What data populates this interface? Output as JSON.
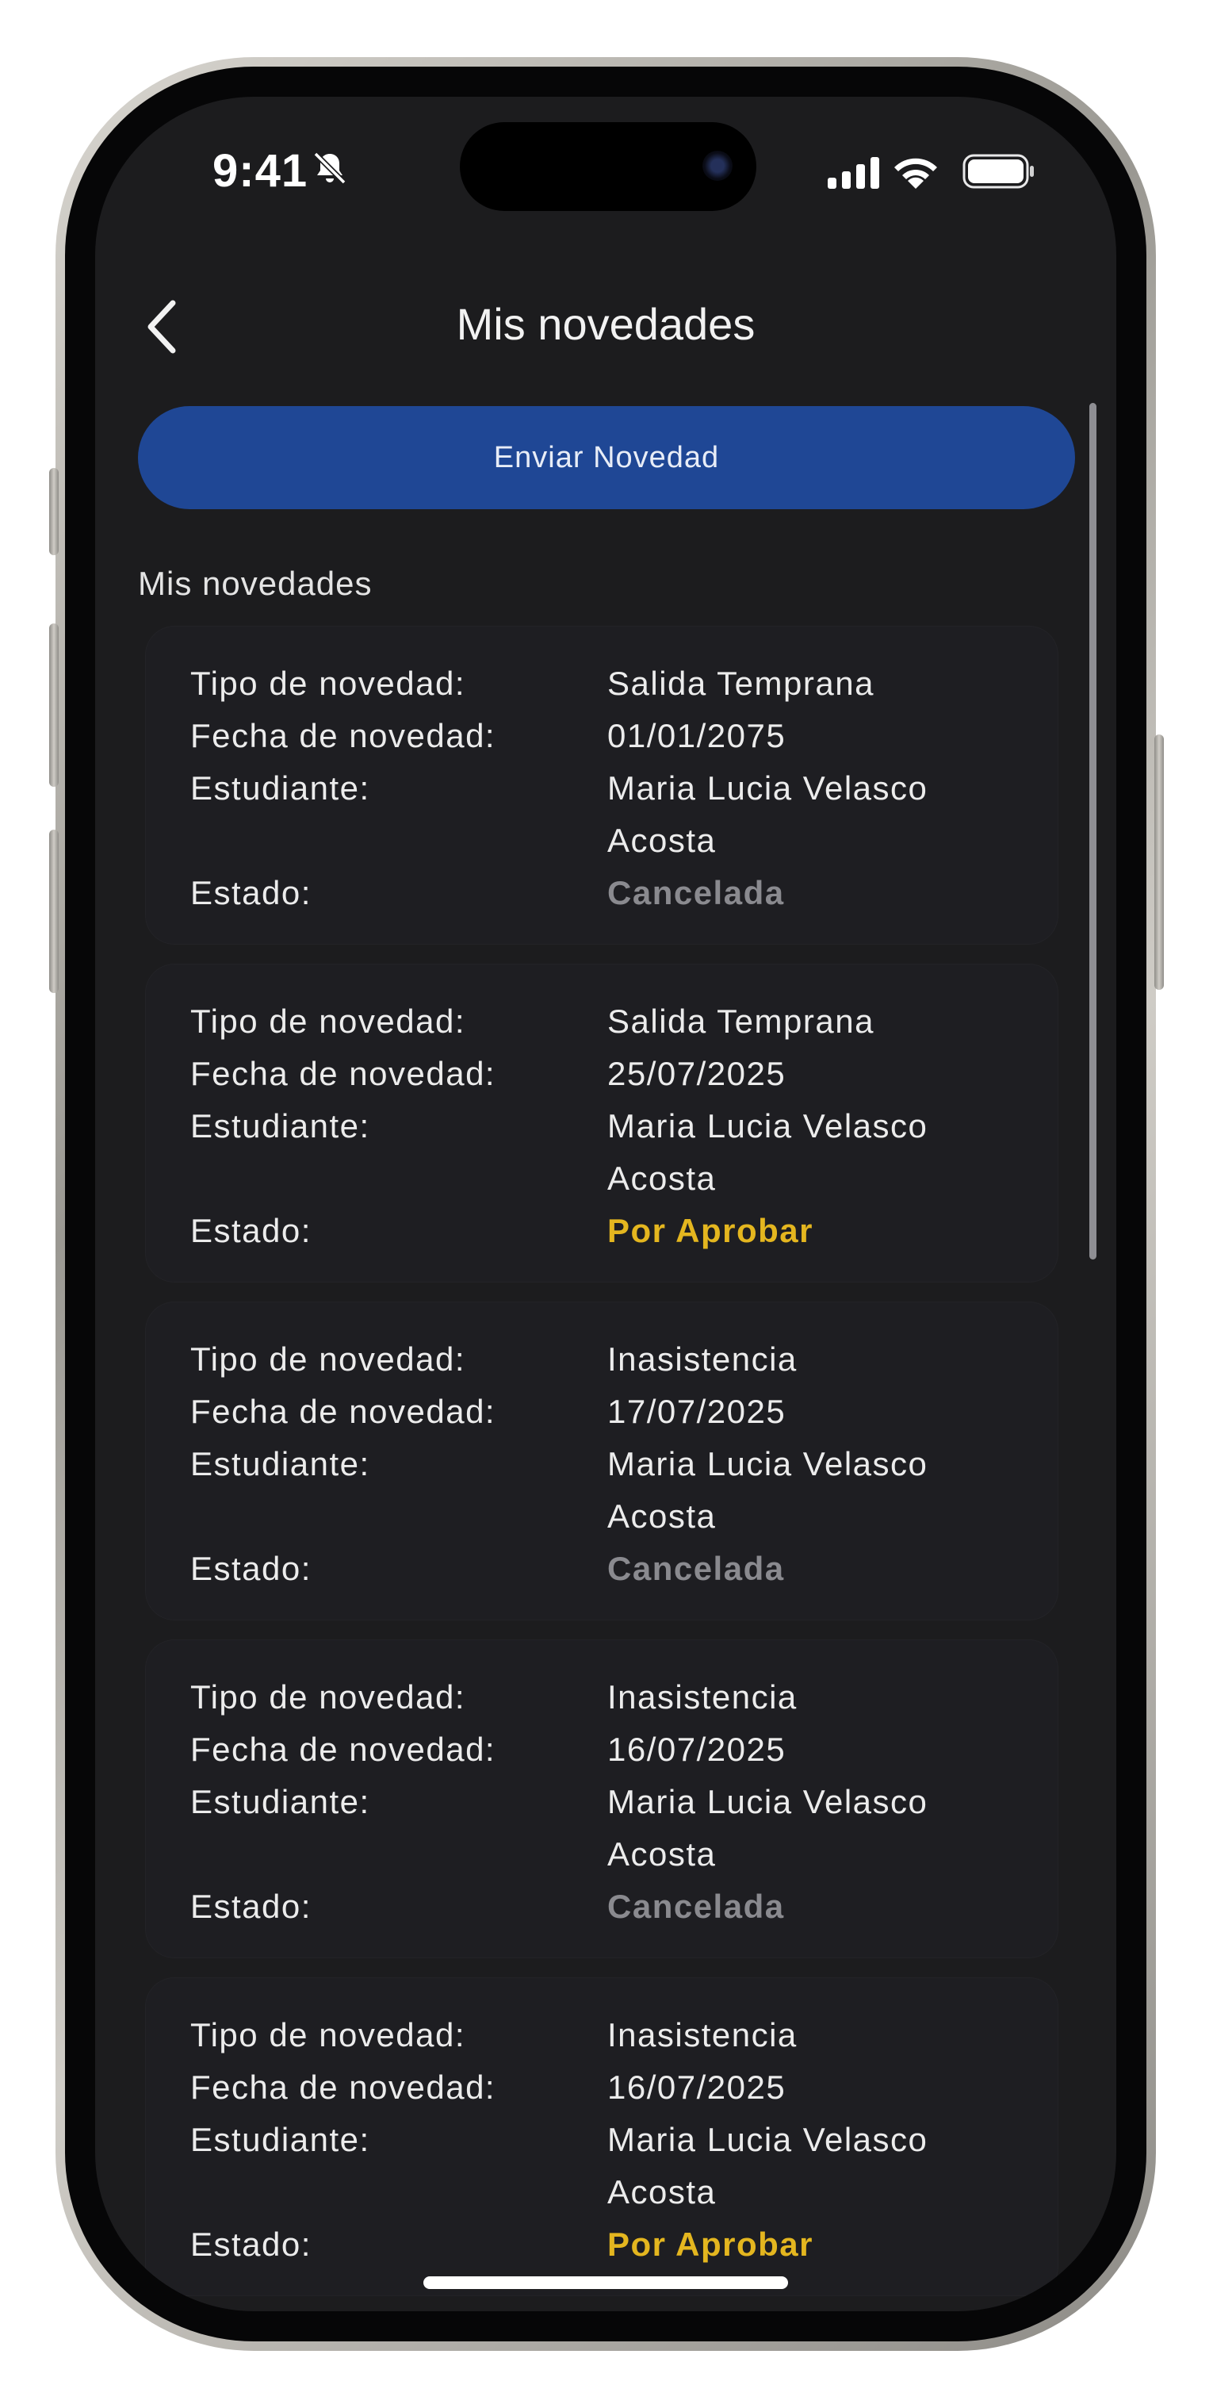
{
  "status_bar": {
    "time": "9:41"
  },
  "header": {
    "title": "Mis novedades"
  },
  "actions": {
    "send_label": "Enviar Novedad"
  },
  "section_title": "Mis novedades",
  "labels": {
    "type": "Tipo de novedad:",
    "date": "Fecha de novedad:",
    "student": "Estudiante:",
    "status": "Estado:"
  },
  "colors": {
    "accent": "#1f4795",
    "pending": "#e4b61f",
    "cancelled": "#8a8a8f"
  },
  "items": [
    {
      "type": "Salida Temprana",
      "date": "01/01/2075",
      "student_line1": "Maria Lucia Velasco",
      "student_line2": "Acosta",
      "status": "Cancelada"
    },
    {
      "type": "Salida Temprana",
      "date": "25/07/2025",
      "student_line1": "Maria Lucia Velasco",
      "student_line2": "Acosta",
      "status": "Por Aprobar"
    },
    {
      "type": "Inasistencia",
      "date": "17/07/2025",
      "student_line1": "Maria Lucia Velasco",
      "student_line2": "Acosta",
      "status": "Cancelada"
    },
    {
      "type": "Inasistencia",
      "date": "16/07/2025",
      "student_line1": "Maria Lucia Velasco",
      "student_line2": "Acosta",
      "status": "Cancelada"
    },
    {
      "type": "Inasistencia",
      "date": "16/07/2025",
      "student_line1": "Maria Lucia Velasco",
      "student_line2": "Acosta",
      "status": "Por Aprobar"
    }
  ]
}
